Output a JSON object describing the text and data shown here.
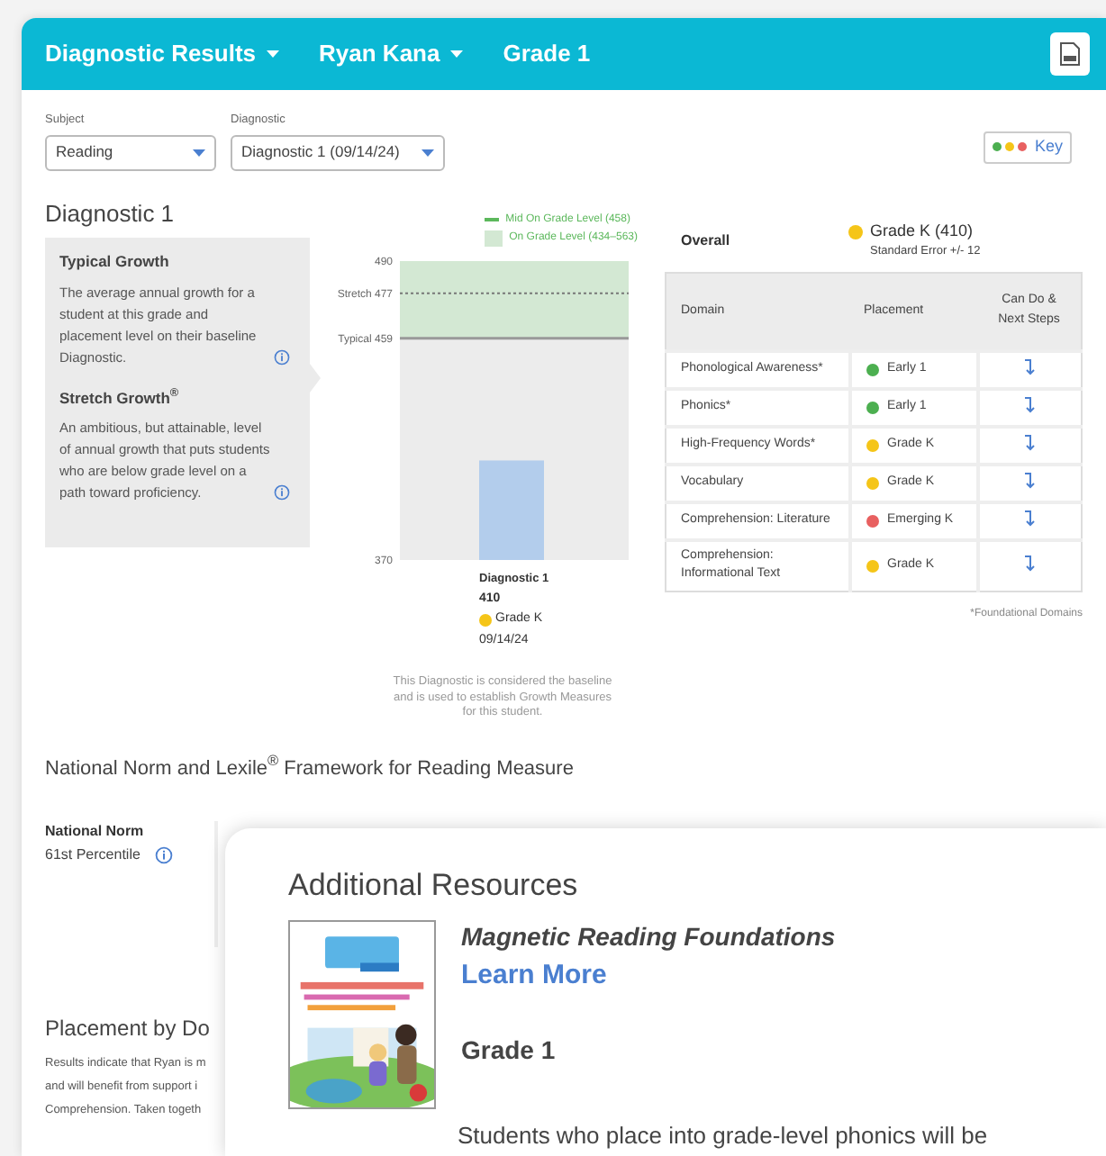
{
  "header": {
    "menus": [
      {
        "label": "Diagnostic Results",
        "dropdown": true
      },
      {
        "label": "Ryan Kana",
        "dropdown": true
      },
      {
        "label": "Grade 1",
        "dropdown": false
      }
    ]
  },
  "filters": [
    {
      "label": "Subject",
      "value": "Reading"
    },
    {
      "label": "Diagnostic",
      "value": "Diagnostic 1 (09/14/24)"
    }
  ],
  "key_button": {
    "label": "Key",
    "dots": [
      {
        "color": "#4caf50"
      },
      {
        "color": "#f5c518"
      },
      {
        "color": "#e86060"
      }
    ]
  },
  "diagnostic": {
    "title": "Diagnostic 1",
    "info_panel": [
      {
        "heading": "Typical Growth",
        "text": "The average annual growth for a student at this grade and placement level on their baseline Diagnostic."
      },
      {
        "heading": "Stretch Growth$^{®}$",
        "text": "An ambitious, but attainable, level of annual growth that puts students who are below grade level on a path toward proficiency."
      }
    ],
    "legend": [
      "Mid On Grade Level (458)",
      "On Grade Level (434–563)"
    ],
    "growth_chart": {
      "scale_labels": [
        "490",
        "Stretch 477",
        "Typical 459",
        "370"
      ],
      "bar": {
        "label": "Diagnostic 1",
        "level": 0.333
      }
    },
    "bar_details": {
      "score": "410",
      "placement": "Grade K",
      "color": "#f5c518",
      "date": "09/14/24"
    },
    "note": "This Diagnostic is considered the baseline and is used to establish Growth Measures for this student."
  },
  "overall": {
    "label": "Overall",
    "placement": "Grade K (410)",
    "color": "#f5c518",
    "standard_error": "Standard Error +/- 12"
  },
  "domain_table": {
    "columns": [
      "Domain",
      "Placement",
      "Can Do & Next Steps"
    ],
    "rows": [
      {
        "domain": "Phonological Awareness*",
        "placement": "Early 1",
        "color": "#4caf50"
      },
      {
        "domain": "Phonics*",
        "placement": "Early 1",
        "color": "#4caf50"
      },
      {
        "domain": "High-Frequency Words*",
        "placement": "Grade K",
        "color": "#f5c518"
      },
      {
        "domain": "Vocabulary",
        "placement": "Grade K",
        "color": "#f5c518"
      },
      {
        "domain": "Comprehension: Literature",
        "placement": "Emerging K",
        "color": "#e86060"
      },
      {
        "domain": "Comprehension: Informational Text",
        "placement": "Grade K",
        "color": "#f5c518"
      }
    ],
    "footnote": "*Foundational Domains"
  },
  "norm_section": {
    "title": "National Norm and Lexile$^{®}$ Framework for Reading Measure",
    "label": "National Norm",
    "value": "61st Percentile"
  },
  "placement_section": {
    "title": "Placement by Do",
    "lines": [
      "Results indicate that Ryan is m",
      "and will benefit from support i",
      "Comprehension. Taken togeth"
    ]
  },
  "resources_dialog": {
    "title": "Additional Resources",
    "resource": {
      "title": "Magnetic Reading Foundations",
      "link": "Learn More",
      "grade": "Grade 1",
      "description": "Students who place into grade-level phonics will be"
    }
  }
}
